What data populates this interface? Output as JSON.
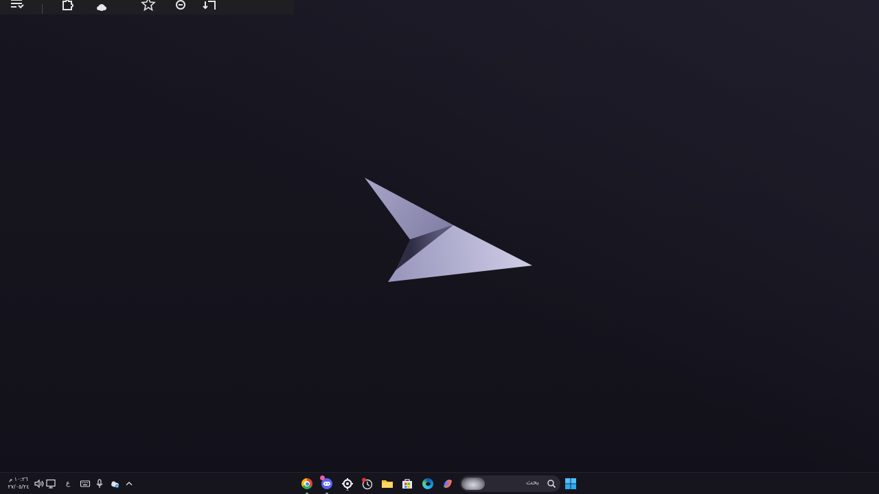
{
  "toolbar": {
    "icons": [
      "reading-list-icon",
      "extensions-icon",
      "profile-icon",
      "favorites-star-icon",
      "zoom-out-icon",
      "download-icon"
    ]
  },
  "desktop": {
    "logo": "paper-airplane-logo"
  },
  "taskbar": {
    "start_icon": "windows-start-icon",
    "search": {
      "placeholder": "بحث",
      "icon": "search-icon"
    },
    "pinned_apps": [
      "chrome-icon",
      "discord-icon",
      "settings-gear-icon",
      "clock-app-icon",
      "file-explorer-icon",
      "microsoft-store-icon",
      "edge-icon",
      "copilot-icon"
    ],
    "tray": {
      "icons": [
        "chevron-up-icon",
        "onedrive-icon",
        "microphone-icon",
        "keyboard-icon",
        "display-icon",
        "speaker-icon"
      ],
      "language": "ع",
      "time": "١٠:٢٦ م",
      "date": "٢٧/٠٥/٢٤"
    }
  },
  "colors": {
    "desktop_background": "#15131c",
    "taskbar_background": "#16151e",
    "logo_light": "#c9c7e2",
    "logo_shadow": "#3d3b55",
    "start_blue": "#4cc2ff"
  }
}
